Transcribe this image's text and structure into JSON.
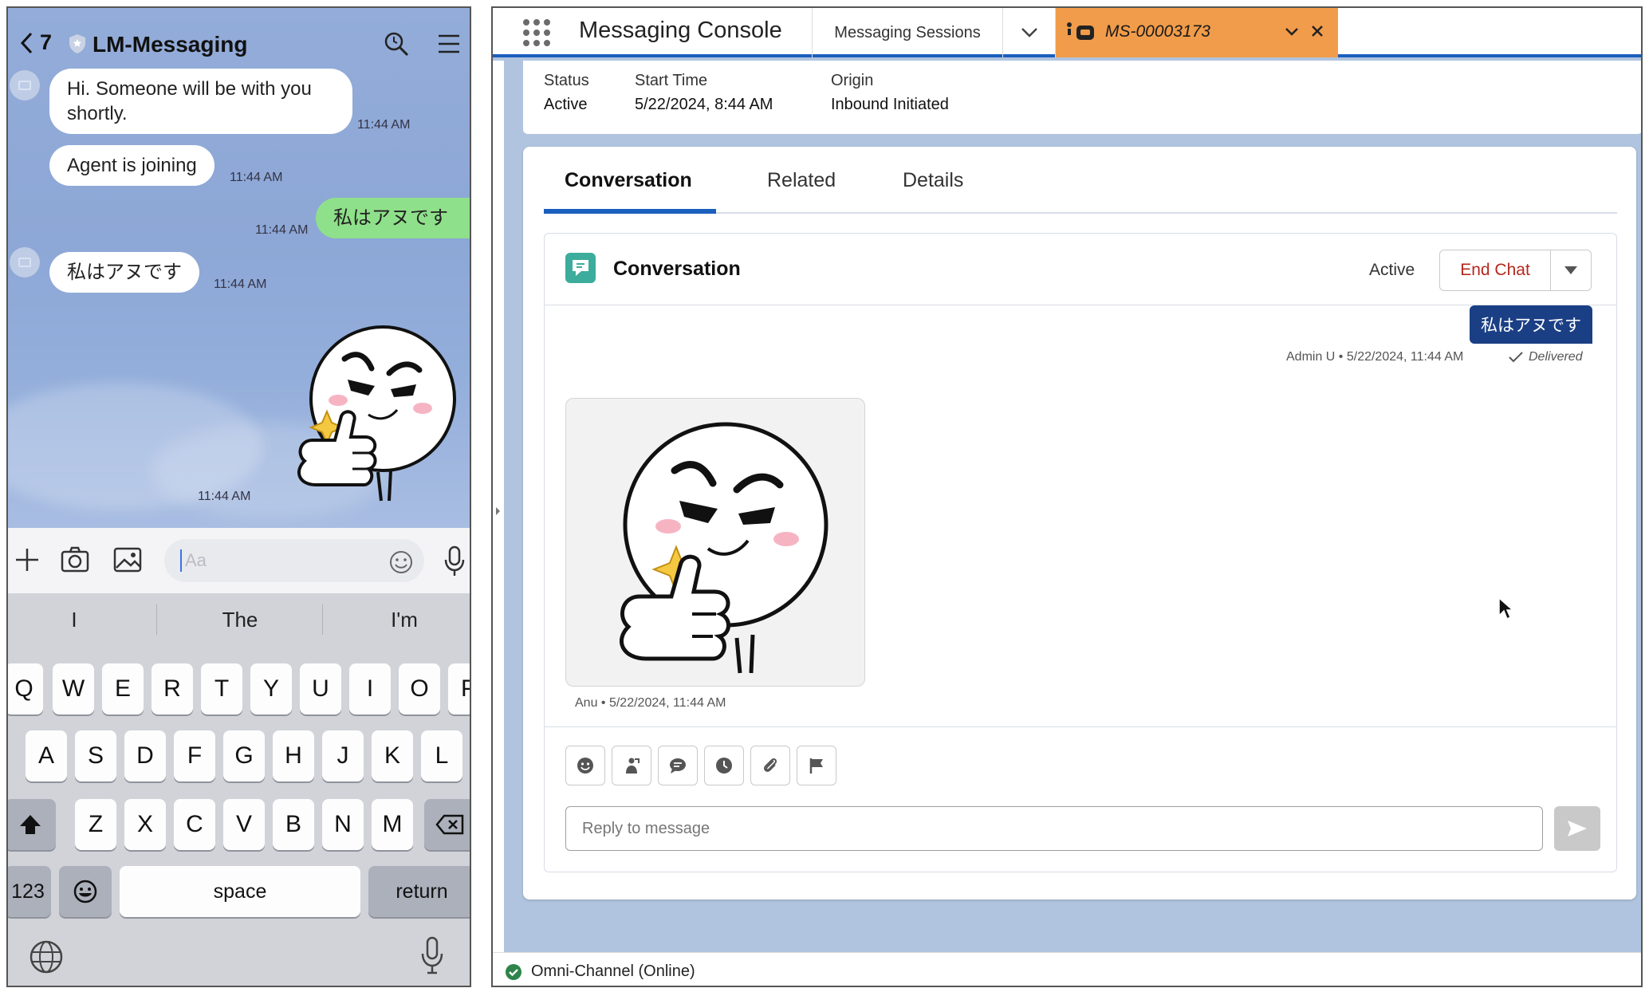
{
  "phone": {
    "back_count": "7",
    "title": "LM-Messaging",
    "messages": [
      {
        "text": "Hi. Someone will be with you shortly.",
        "time": "11:44 AM"
      },
      {
        "text": "Agent is joining",
        "time": "11:44 AM"
      },
      {
        "text": "私はアヌです",
        "time": "11:44 AM"
      },
      {
        "text": "私はアヌです",
        "time": "11:44 AM"
      }
    ],
    "sticker_time": "11:44 AM",
    "input_placeholder": "Aa",
    "suggestions": [
      "I",
      "The",
      "I'm"
    ],
    "keys": {
      "row1": [
        "Q",
        "W",
        "E",
        "R",
        "T",
        "Y",
        "U",
        "I",
        "O",
        "P"
      ],
      "row2": [
        "A",
        "S",
        "D",
        "F",
        "G",
        "H",
        "J",
        "K",
        "L"
      ],
      "row3": [
        "Z",
        "X",
        "C",
        "V",
        "B",
        "N",
        "M"
      ],
      "num": "123",
      "space": "space",
      "return": "return"
    }
  },
  "console": {
    "app_name": "Messaging Console",
    "nav_tab": "Messaging Sessions",
    "active_tab": "MS-00003173",
    "highlights": {
      "status_label": "Status",
      "status_value": "Active",
      "start_label": "Start Time",
      "start_value": "5/22/2024, 8:44 AM",
      "origin_label": "Origin",
      "origin_value": "Inbound Initiated"
    },
    "tabs": [
      "Conversation",
      "Related",
      "Details"
    ],
    "conversation": {
      "title": "Conversation",
      "status": "Active",
      "end_chat": "End Chat",
      "outgoing_text": "私はアヌです",
      "outgoing_meta": "Admin U • 5/22/2024, 11:44 AM",
      "delivered": "Delivered",
      "incoming_meta": "Anu • 5/22/2024, 11:44 AM",
      "reply_placeholder": "Reply to message"
    },
    "footer": "Omni-Channel (Online)"
  },
  "colors": {
    "brand_blue": "#1b5fbd",
    "active_tab": "#f19c4a",
    "end_chat_red": "#b5281d",
    "outgoing_bubble": "#1b3f85",
    "line_green": "#8fe08a",
    "online_green": "#2e844a"
  }
}
